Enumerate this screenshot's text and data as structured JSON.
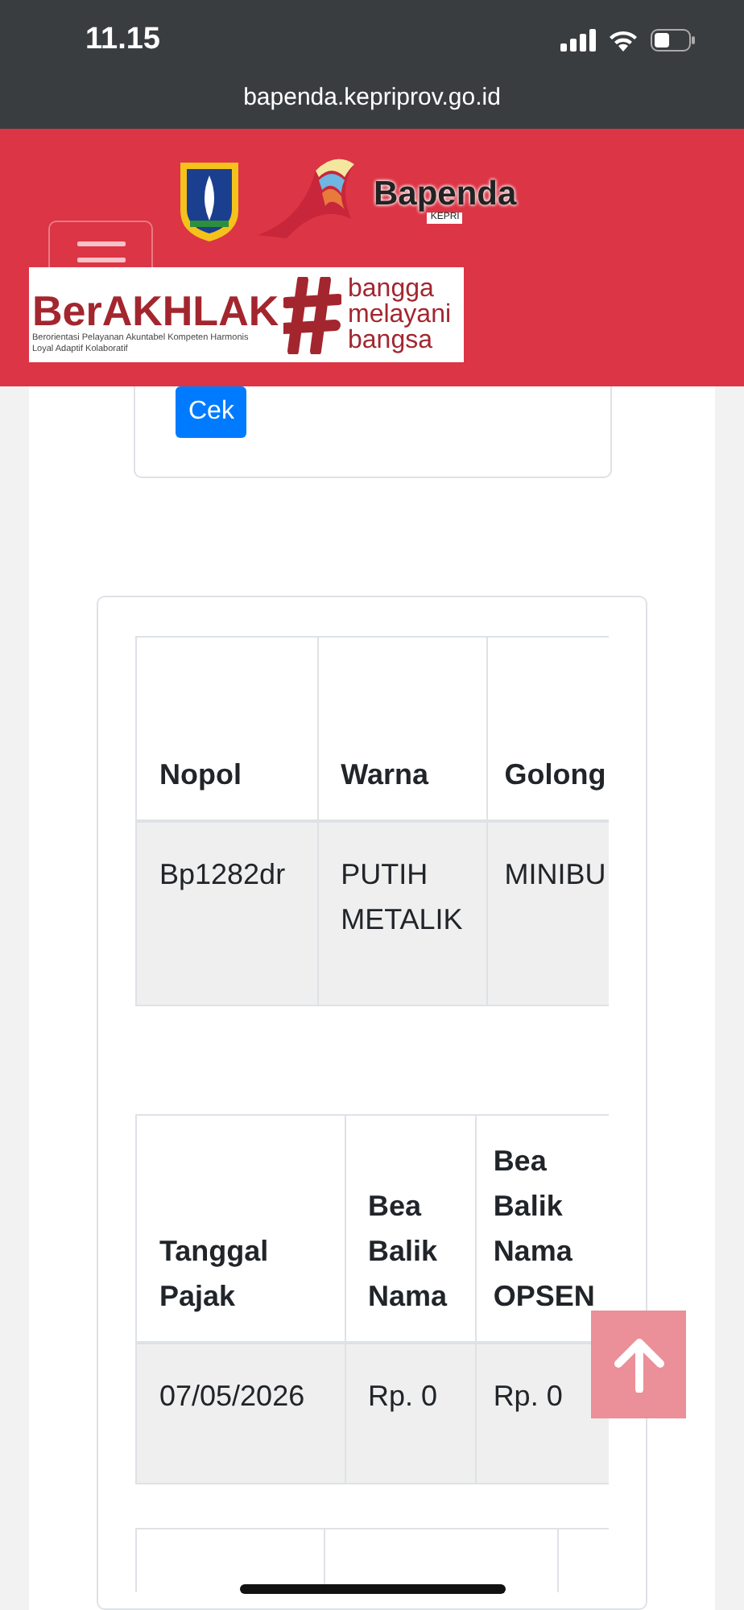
{
  "status_bar": {
    "time": "11.15"
  },
  "address_bar": {
    "url": "bapenda.kepriprov.go.id"
  },
  "header": {
    "logo_text": "Bapenda",
    "logo_subtext": "KEPRI",
    "banner": {
      "title": "BerAKHLAK",
      "tagline": "Berorientasi Pelayanan Akuntabel Kompeten Harmonis Loyal Adaptif Kolaboratif",
      "slogan": [
        "bangga",
        "melayani",
        "bangsa"
      ]
    }
  },
  "form": {
    "button": "Cek"
  },
  "tables": [
    {
      "columns": [
        "Nopol",
        "Warna",
        "Golong"
      ],
      "rows": [
        [
          "Bp1282dr",
          "PUTIH METALIK",
          "MINIBU"
        ]
      ]
    },
    {
      "columns": [
        "Tanggal Pajak",
        "Bea Balik Nama",
        "Bea Balik Nama OPSEN"
      ],
      "rows": [
        [
          "07/05/2026",
          "Rp. 0",
          "Rp. 0"
        ]
      ]
    }
  ]
}
